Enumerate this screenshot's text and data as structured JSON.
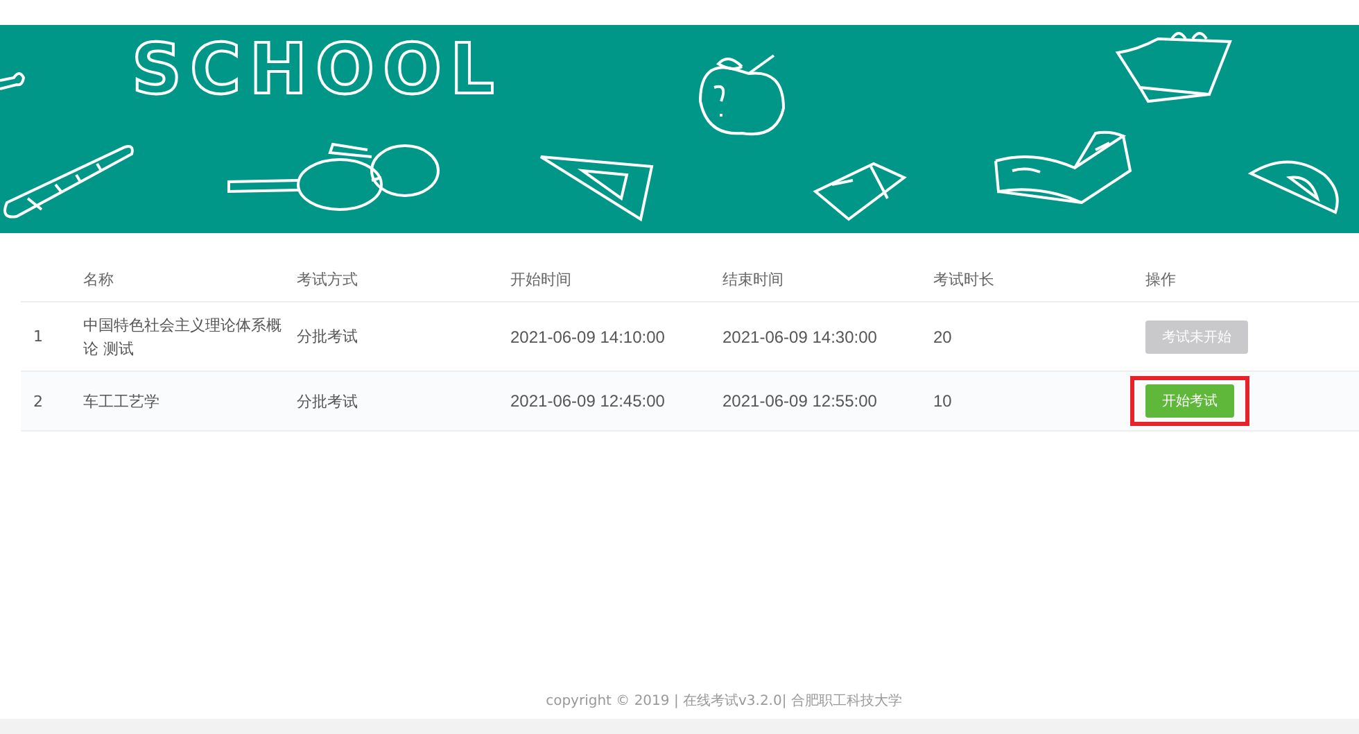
{
  "banner": {
    "title": "SCHOOL"
  },
  "table": {
    "columns": [
      "名称",
      "考试方式",
      "开始时间",
      "结束时间",
      "考试时长",
      "操作"
    ],
    "rows": [
      {
        "index": "1",
        "name": "中国特色社会主义理论体系概论 测试",
        "method": "分批考试",
        "start": "2021-06-09 14:10:00",
        "end": "2021-06-09 14:30:00",
        "duration": "20",
        "action": {
          "label": "考试未开始",
          "disabled": true,
          "highlighted": false
        }
      },
      {
        "index": "2",
        "name": "车工工艺学",
        "method": "分批考试",
        "start": "2021-06-09 12:45:00",
        "end": "2021-06-09 12:55:00",
        "duration": "10",
        "action": {
          "label": "开始考试",
          "disabled": false,
          "highlighted": true
        }
      }
    ]
  },
  "footer": "copyright © 2019 | 在线考试v3.2.0| 合肥职工科技大学"
}
